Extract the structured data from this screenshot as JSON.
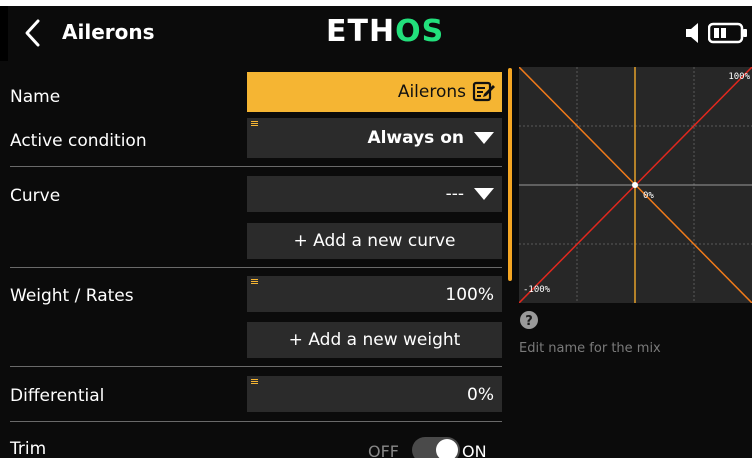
{
  "header": {
    "title": "Ailerons",
    "logo_left": "ETH",
    "logo_right": "OS",
    "back_icon": "chevron-left-icon",
    "speaker_icon": "speaker-icon",
    "battery_icon": "battery-icon"
  },
  "fields": {
    "name": {
      "label": "Name",
      "value": "Ailerons",
      "icon": "edit-icon"
    },
    "active_condition": {
      "label": "Active condition",
      "value": "Always on"
    },
    "curve": {
      "label": "Curve",
      "value": "---",
      "add_label": "+ Add a new curve"
    },
    "weight": {
      "label": "Weight / Rates",
      "value": "100%",
      "add_label": "+ Add a new weight"
    },
    "differential": {
      "label": "Differential",
      "value": "0%"
    },
    "trim": {
      "label": "Trim",
      "off_label": "OFF",
      "on_label": "ON",
      "state": "on"
    }
  },
  "graph": {
    "top_right": "100%",
    "center": "0%",
    "bottom_left": "-100%"
  },
  "help": {
    "icon": "help-icon",
    "text": "Edit name for the mix"
  },
  "colors": {
    "accent": "#f5a623",
    "name_field": "#f5b533",
    "logo_green": "#22e07c",
    "curve_line": "#e0281e",
    "diag_line": "#f07a1a"
  }
}
